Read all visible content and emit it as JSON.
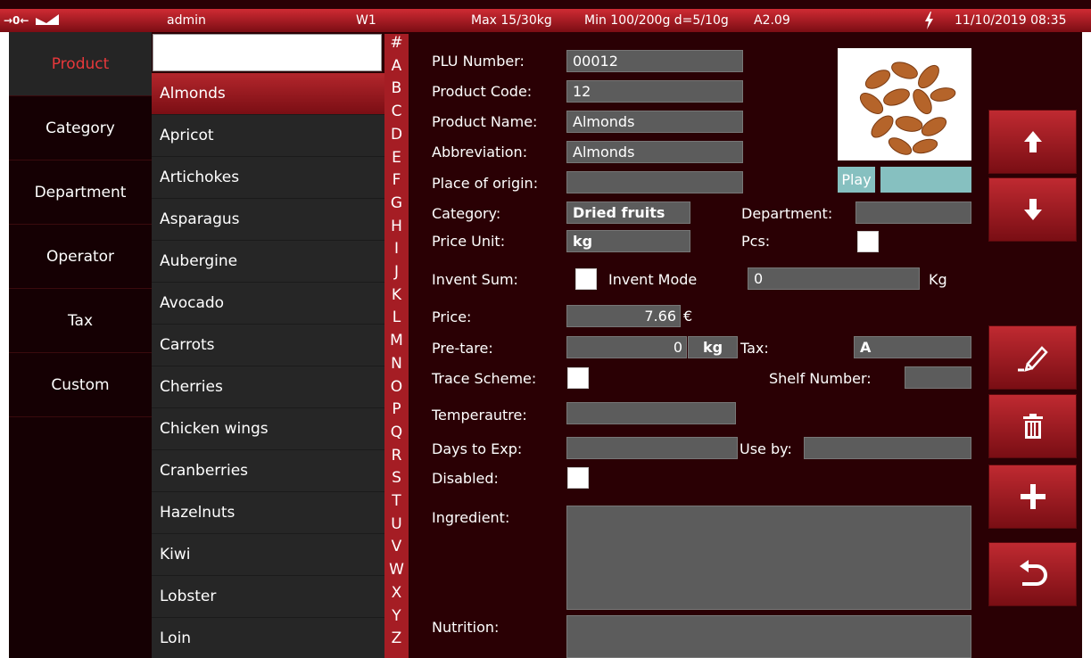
{
  "status": {
    "units_indicator": "→0←",
    "user": "admin",
    "scale_id": "W1",
    "capacity": "Max 15/30kg",
    "min_division": "Min 100/200g d=5/10g",
    "version": "A2.09",
    "datetime": "11/10/2019 08:35"
  },
  "menu": {
    "items": [
      {
        "label": "Product",
        "active": true
      },
      {
        "label": "Category"
      },
      {
        "label": "Department"
      },
      {
        "label": "Operator"
      },
      {
        "label": "Tax"
      },
      {
        "label": "Custom"
      }
    ]
  },
  "search": {
    "value": ""
  },
  "products": [
    {
      "name": "Almonds",
      "active": true
    },
    {
      "name": "Apricot"
    },
    {
      "name": "Artichokes"
    },
    {
      "name": "Asparagus"
    },
    {
      "name": "Aubergine"
    },
    {
      "name": "Avocado"
    },
    {
      "name": "Carrots"
    },
    {
      "name": "Cherries"
    },
    {
      "name": "Chicken wings"
    },
    {
      "name": "Cranberries"
    },
    {
      "name": "Hazelnuts"
    },
    {
      "name": "Kiwi"
    },
    {
      "name": "Lobster"
    },
    {
      "name": "Loin"
    }
  ],
  "alphabet": [
    "#",
    "A",
    "B",
    "C",
    "D",
    "E",
    "F",
    "G",
    "H",
    "I",
    "J",
    "K",
    "L",
    "M",
    "N",
    "O",
    "P",
    "Q",
    "R",
    "S",
    "T",
    "U",
    "V",
    "W",
    "X",
    "Y",
    "Z"
  ],
  "form": {
    "plu_label": "PLU Number:",
    "plu_value": "00012",
    "code_label": "Product Code:",
    "code_value": "12",
    "name_label": "Product Name:",
    "name_value": "Almonds",
    "abbr_label": "Abbreviation:",
    "abbr_value": "Almonds",
    "origin_label": "Place of origin:",
    "origin_value": "",
    "play_label": "Play",
    "category_label": "Category:",
    "category_value": "Dried fruits",
    "department_label": "Department:",
    "department_value": "",
    "price_unit_label": "Price Unit:",
    "price_unit_value": "kg",
    "pcs_label": "Pcs:",
    "invent_sum_label": "Invent Sum:",
    "invent_mode_label": "Invent Mode",
    "invent_mode_value": "0",
    "invent_unit": "Kg",
    "price_label": "Price:",
    "price_value": "7.66",
    "currency": "€",
    "pretare_label": "Pre-tare:",
    "pretare_value": "0",
    "pretare_unit": "kg",
    "tax_label": "Tax:",
    "tax_value": "A",
    "trace_label": "Trace Scheme:",
    "shelf_label": "Shelf Number:",
    "shelf_value": "",
    "temp_label": "Temperautre:",
    "temp_value": "",
    "days_label": "Days to Exp:",
    "days_value": "",
    "useby_label": "Use by:",
    "useby_value": "",
    "disabled_label": "Disabled:",
    "ingredient_label": "Ingredient:",
    "ingredient_value": "",
    "nutrition_label": "Nutrition:",
    "nutrition_value": ""
  },
  "actions": [
    {
      "name": "arrow-up-icon"
    },
    {
      "name": "arrow-down-icon"
    },
    {
      "name": "edit-pencil-icon"
    },
    {
      "name": "trash-icon"
    },
    {
      "name": "plus-icon"
    },
    {
      "name": "return-icon"
    }
  ],
  "colors": {
    "accent": "#a51d24",
    "background": "#2a0004",
    "field": "#5c5c5c",
    "play": "#86c0c0",
    "active_text": "#e8383b"
  }
}
